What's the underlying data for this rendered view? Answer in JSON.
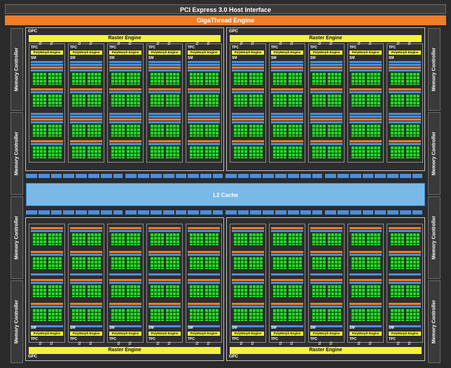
{
  "header": {
    "pcie": "PCI Express 3.0 Host Interface",
    "gigathread": "GigaThread Engine"
  },
  "memory_controller_label": "Memory Controller",
  "l2_label": "L2 Cache",
  "gpc": {
    "label": "GPC",
    "raster_engine": "Raster Engine",
    "tpc_label": "TPC",
    "sm_label": "SM",
    "polymorph_engine": "PolyMorph Engine"
  },
  "colors": {
    "background": "#2b2b2b",
    "gigathread": "#f07d28",
    "raster": "#f2f23c",
    "cores": "#2fd12f",
    "l2_cache": "#7ab8e8",
    "bars_blue": "#4a8fdc",
    "bars_orange": "#f07d28"
  }
}
